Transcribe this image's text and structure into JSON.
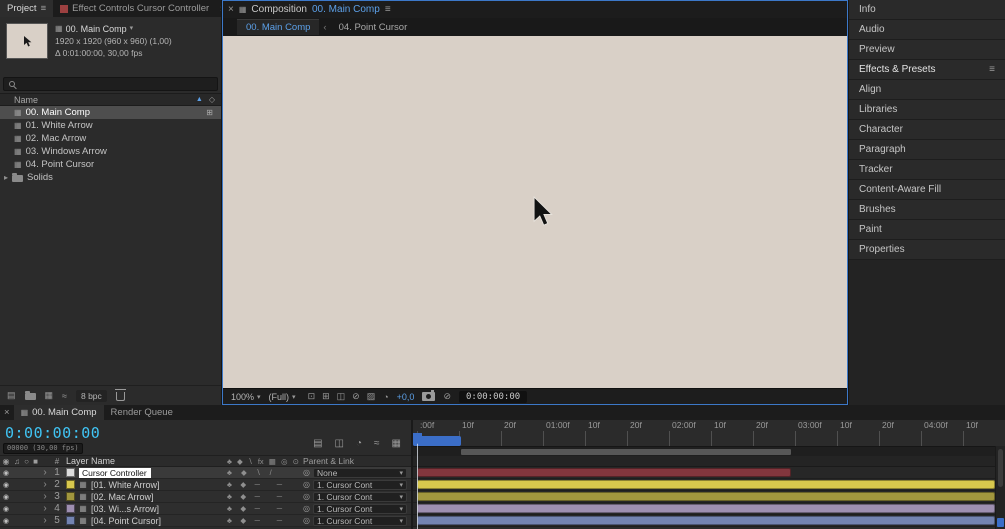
{
  "colors": {
    "accent_blue": "#5ca0e8",
    "timecode_cyan": "#40c4f4",
    "canvas_beige": "#d9d0c7",
    "cache_blue": "#3b6ec8"
  },
  "project_panel": {
    "tabs": [
      {
        "label": "Project"
      },
      {
        "label": "Effect Controls Cursor Controller"
      }
    ],
    "comp_info": {
      "name": "00. Main Comp",
      "size_line": "1920 x 1920 (960 x 960) (1,00)",
      "time_line": "Δ 0:01:00:00, 30,00 fps"
    },
    "columns": {
      "name": "Name"
    },
    "items": [
      {
        "label": "00. Main Comp",
        "type": "composition"
      },
      {
        "label": "01. White Arrow",
        "type": "composition"
      },
      {
        "label": "02. Mac Arrow",
        "type": "composition"
      },
      {
        "label": "03. Windows Arrow",
        "type": "composition"
      },
      {
        "label": "04. Point Cursor",
        "type": "composition"
      },
      {
        "label": "Solids",
        "type": "folder"
      }
    ],
    "footer": {
      "bit_depth": "8 bpc"
    }
  },
  "comp_panel": {
    "panel_title": "Composition",
    "active_comp": "00. Main Comp",
    "viewer_tabs": [
      {
        "label": "00. Main Comp",
        "active": true
      },
      {
        "label": "04. Point Cursor",
        "active": false
      }
    ],
    "footer": {
      "zoom": "100%",
      "resolution": "(Full)",
      "exposure": "+0,0",
      "timecode": "0:00:00:00"
    }
  },
  "sidebar": {
    "items": [
      {
        "label": "Info"
      },
      {
        "label": "Audio"
      },
      {
        "label": "Preview"
      },
      {
        "label": "Effects & Presets"
      },
      {
        "label": "Align"
      },
      {
        "label": "Libraries"
      },
      {
        "label": "Character"
      },
      {
        "label": "Paragraph"
      },
      {
        "label": "Tracker"
      },
      {
        "label": "Content-Aware Fill"
      },
      {
        "label": "Brushes"
      },
      {
        "label": "Paint"
      },
      {
        "label": "Properties"
      }
    ]
  },
  "timeline": {
    "tabs": [
      {
        "label": "00. Main Comp",
        "active": true
      },
      {
        "label": "Render Queue",
        "active": false
      }
    ],
    "timecode": "0:00:00:00",
    "frame_counter": "00000 (30,00 fps)",
    "columns": {
      "number": "#",
      "layer_name": "Layer Name",
      "parent": "Parent & Link"
    },
    "layers": [
      {
        "num": "1",
        "name": "Cursor Controller",
        "parent": "None",
        "color": "#82363d",
        "swatch": "#dcdcdc"
      },
      {
        "num": "2",
        "name": "[01. White Arrow]",
        "parent": "1. Cursor Cont",
        "color": "#d8c84d",
        "swatch": "#d8c84d"
      },
      {
        "num": "3",
        "name": "[02. Mac Arrow]",
        "parent": "1. Cursor Cont",
        "color": "#a2973e",
        "swatch": "#a2973e"
      },
      {
        "num": "4",
        "name": "[03. Wi...s Arrow]",
        "parent": "1. Cursor Cont",
        "color": "#9e8fb1",
        "swatch": "#9e8fb1"
      },
      {
        "num": "5",
        "name": "[04. Point Cursor]",
        "parent": "1. Cursor Cont",
        "color": "#7383b1",
        "swatch": "#7383b1"
      }
    ],
    "ruler_ticks": [
      ":00f",
      "10f",
      "20f",
      "01:00f",
      "10f",
      "20f",
      "02:00f",
      "10f",
      "20f",
      "03:00f",
      "10f",
      "20f",
      "04:00f",
      "10f"
    ]
  }
}
